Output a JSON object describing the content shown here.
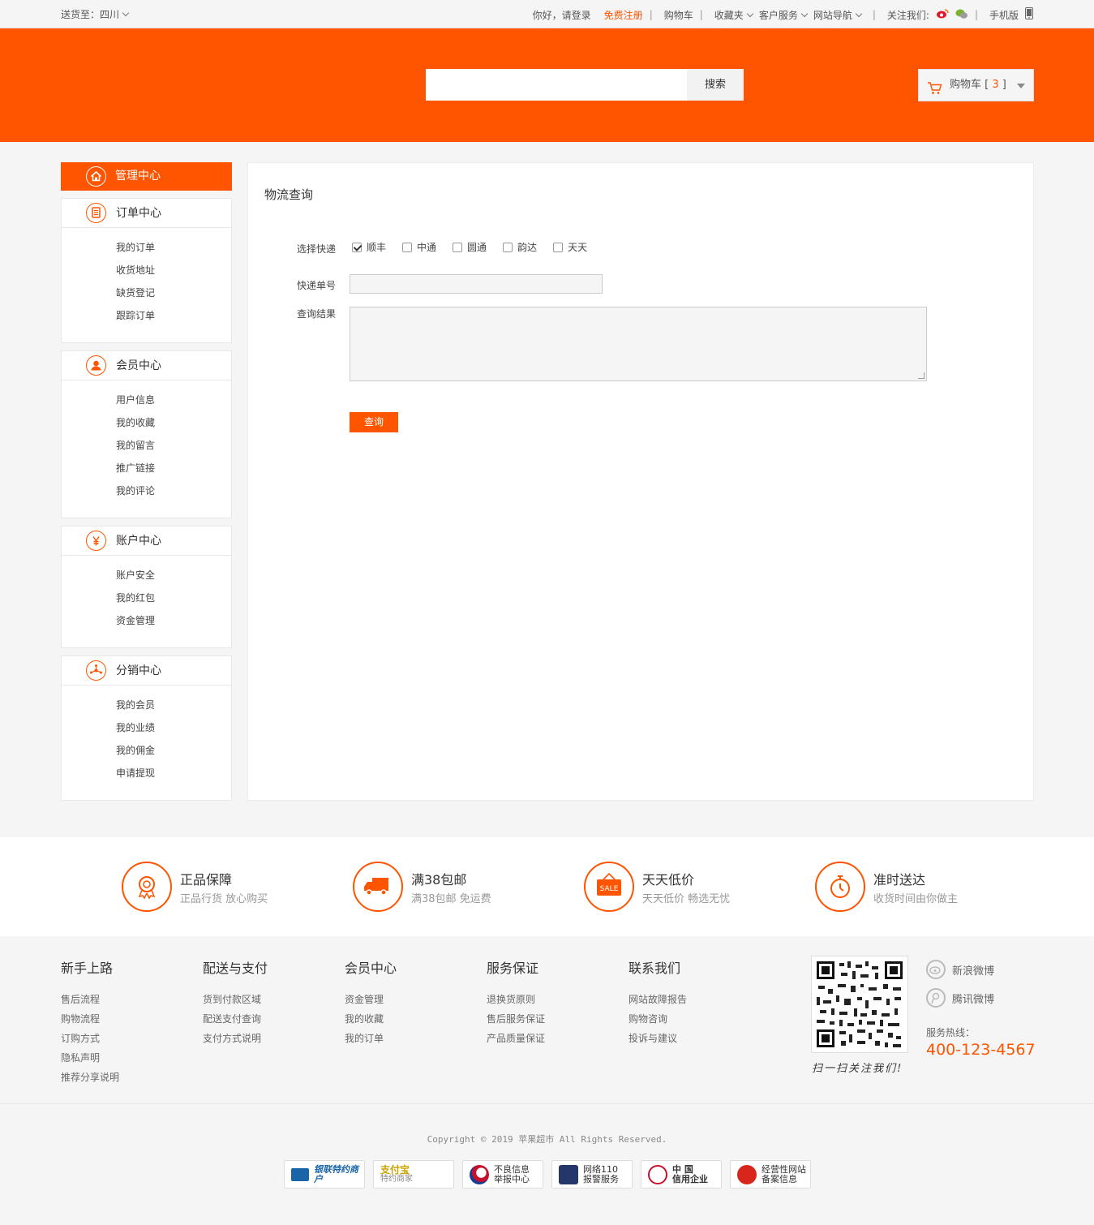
{
  "colors": {
    "accent": "#ff5400",
    "bg": "#f5f5f5"
  },
  "topbar": {
    "ship_to": "送货至：四川",
    "greeting": "你好，请登录",
    "register": "免费注册",
    "cart": "购物车",
    "favorites": "收藏夹",
    "service": "客户服务",
    "site_nav": "网站导航",
    "follow": "关注我们:",
    "mobile": "手机版"
  },
  "header": {
    "search_placeholder": "",
    "search_button": "搜索",
    "cart_label": "购物车",
    "cart_count": "3"
  },
  "sidebar": {
    "head": "管理中心",
    "groups": [
      {
        "title": "订单中心",
        "items": [
          "我的订单",
          "收货地址",
          "缺货登记",
          "跟踪订单"
        ]
      },
      {
        "title": "会员中心",
        "items": [
          "用户信息",
          "我的收藏",
          "我的留言",
          "推广链接",
          "我的评论"
        ]
      },
      {
        "title": "账户中心",
        "items": [
          "账户安全",
          "我的红包",
          "资金管理"
        ]
      },
      {
        "title": "分销中心",
        "items": [
          "我的会员",
          "我的业绩",
          "我的佣金",
          "申请提现"
        ]
      }
    ]
  },
  "main": {
    "title": "物流查询",
    "courier_label": "选择快递",
    "couriers": [
      "顺丰",
      "中通",
      "圆通",
      "韵达",
      "天天"
    ],
    "tracking_label": "快递单号",
    "tracking_value": "",
    "result_label": "查询结果",
    "query_button": "查询"
  },
  "services": [
    {
      "title": "正品保障",
      "desc": "正品行货 放心购买",
      "icon": "medal-icon"
    },
    {
      "title": "满38包邮",
      "desc": "满38包邮 免运费",
      "icon": "truck-icon"
    },
    {
      "title": "天天低价",
      "desc": "天天低价 畅选无忧",
      "icon": "sale-tag-icon"
    },
    {
      "title": "准时送达",
      "desc": "收货时间由你做主",
      "icon": "stopwatch-icon"
    }
  ],
  "footer": {
    "columns": [
      {
        "title": "新手上路",
        "links": [
          "售后流程",
          "购物流程",
          "订购方式",
          "隐私声明",
          "推荐分享说明"
        ]
      },
      {
        "title": "配送与支付",
        "links": [
          "货到付款区域",
          "配送支付查询",
          "支付方式说明"
        ]
      },
      {
        "title": "会员中心",
        "links": [
          "资金管理",
          "我的收藏",
          "我的订单"
        ]
      },
      {
        "title": "服务保证",
        "links": [
          "退换货原则",
          "售后服务保证",
          "产品质量保证"
        ]
      },
      {
        "title": "联系我们",
        "links": [
          "网站故障报告",
          "购物咨询",
          "投诉与建议"
        ]
      }
    ],
    "qr_caption": "扫一扫关注我们!",
    "weibo_sina": "新浪微博",
    "weibo_tencent": "腾讯微博",
    "hotline_label": "服务热线：",
    "hotline": "400-123-4567",
    "copyright": "Copyright © 2019 苹果超市 All Rights Reserved.",
    "badges": [
      {
        "l1": "银联特约商户",
        "l2": ""
      },
      {
        "l1": "支付宝",
        "l2": "特约商家"
      },
      {
        "l1": "不良信息",
        "l2": "举报中心"
      },
      {
        "l1": "网络110",
        "l2": "报警服务"
      },
      {
        "l1": "中 国",
        "l2": "信用企业"
      },
      {
        "l1": "经营性网站",
        "l2": "备案信息"
      }
    ]
  }
}
